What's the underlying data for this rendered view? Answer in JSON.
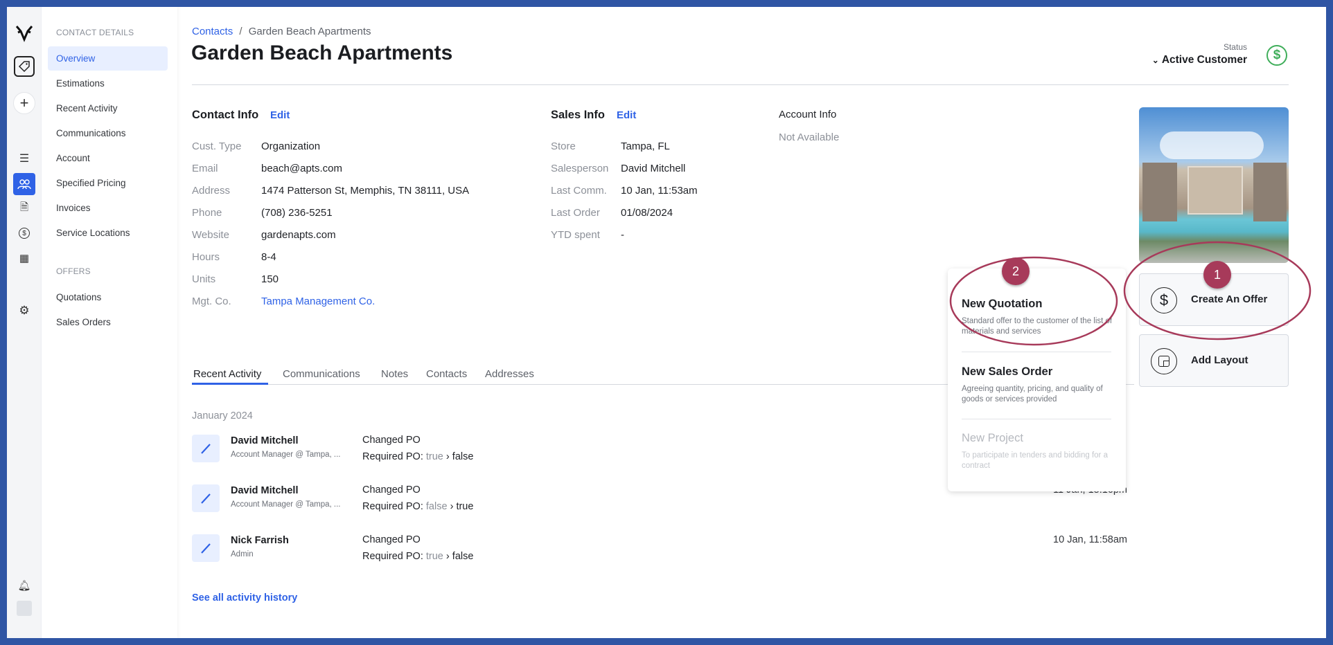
{
  "sidebar": {
    "section1": "CONTACT DETAILS",
    "items": [
      "Overview",
      "Estimations",
      "Recent Activity",
      "Communications",
      "Account",
      "Specified Pricing",
      "Invoices",
      "Service Locations"
    ],
    "section2": "OFFERS",
    "offers": [
      "Quotations",
      "Sales Orders"
    ]
  },
  "breadcrumb": {
    "root": "Contacts",
    "sep": "/",
    "current": "Garden Beach Apartments"
  },
  "title": "Garden Beach Apartments",
  "status": {
    "label": "Status",
    "value": "Active Customer",
    "color": "#3fae5a"
  },
  "contact_info": {
    "heading": "Contact Info",
    "edit": "Edit",
    "rows": [
      [
        "Cust. Type",
        "Organization"
      ],
      [
        "Email",
        "beach@apts.com"
      ],
      [
        "Address",
        "1474 Patterson St, Memphis, TN 38111, USA"
      ],
      [
        "Phone",
        "(708) 236-5251"
      ],
      [
        "Website",
        "gardenapts.com"
      ],
      [
        "Hours",
        "8-4"
      ],
      [
        "Units",
        "150"
      ],
      [
        "Mgt. Co.",
        "Tampa Management Co."
      ]
    ]
  },
  "sales_info": {
    "heading": "Sales Info",
    "edit": "Edit",
    "rows": [
      [
        "Store",
        "Tampa, FL"
      ],
      [
        "Salesperson",
        "David Mitchell"
      ],
      [
        "Last Comm.",
        "10 Jan, 11:53am"
      ],
      [
        "Last Order",
        "01/08/2024"
      ],
      [
        "YTD spent",
        "-"
      ]
    ]
  },
  "account_info": {
    "heading": "Account Info",
    "value": "Not Available"
  },
  "tabs": [
    "Recent Activity",
    "Communications",
    "Notes",
    "Contacts",
    "Addresses"
  ],
  "activity": {
    "month": "January 2024",
    "items": [
      {
        "name": "David Mitchell",
        "role": "Account Manager @ Tampa, ...",
        "action": "Changed PO",
        "field": "Required PO:",
        "from": "true",
        "to": "false",
        "time": ""
      },
      {
        "name": "David Mitchell",
        "role": "Account Manager @ Tampa, ...",
        "action": "Changed PO",
        "field": "Required PO:",
        "from": "false",
        "to": "true",
        "time": "11 Jan, 15:16pm"
      },
      {
        "name": "Nick Farrish",
        "role": "Admin",
        "action": "Changed PO",
        "field": "Required PO:",
        "from": "true",
        "to": "false",
        "time": "10 Jan, 11:58am"
      }
    ],
    "see_all": "See all activity history",
    "arrow": "›"
  },
  "actions": {
    "create_offer": "Create An Offer",
    "add_layout": "Add Layout"
  },
  "popup": {
    "items": [
      {
        "title": "New Quotation",
        "desc": "Standard offer to the customer of the list of materials and services"
      },
      {
        "title": "New Sales Order",
        "desc": "Agreeing quantity, pricing, and quality of goods or services provided"
      },
      {
        "title": "New Project",
        "desc": "To participate in tenders and bidding for a contract",
        "disabled": true
      }
    ]
  },
  "annotations": {
    "badge1": "1",
    "badge2": "2",
    "color": "#a73a5a"
  },
  "accent": "#2f62e6"
}
